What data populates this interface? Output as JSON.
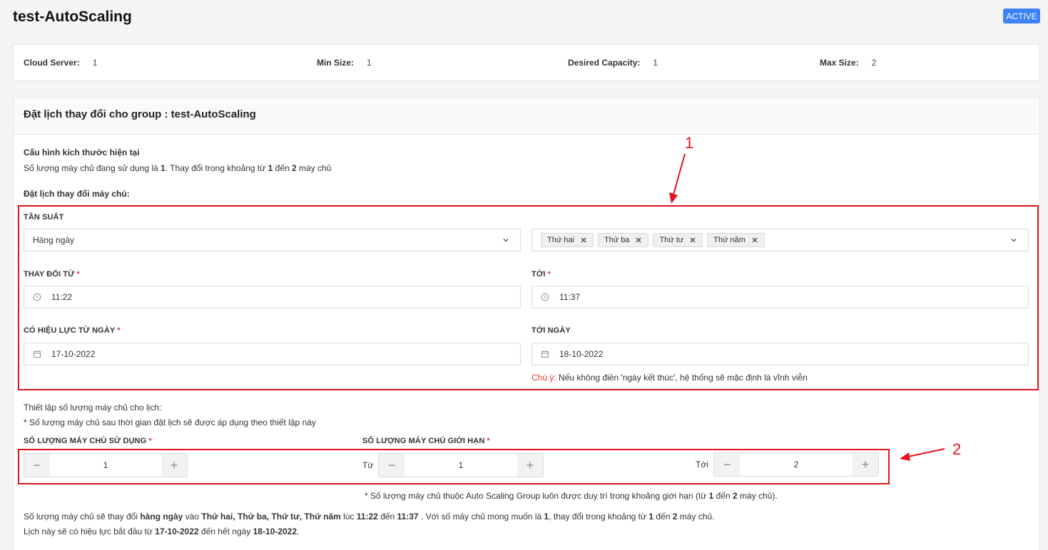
{
  "header": {
    "title": "test-AutoScaling",
    "status": "ACTIVE"
  },
  "summary": [
    {
      "label": "Cloud Server:",
      "value": "1"
    },
    {
      "label": "Min Size:",
      "value": "1"
    },
    {
      "label": "Desired Capacity:",
      "value": "1"
    },
    {
      "label": "Max Size:",
      "value": "2"
    }
  ],
  "card": {
    "title": "Đặt lịch thay đổi cho group : test-AutoScaling",
    "current_config_title": "Cấu hình kích thước hiện tại",
    "current_config": {
      "p1": "Số lượng máy chủ đang sử dụng là ",
      "v1": "1",
      "p2": ". Thay đổi trong khoảng từ ",
      "v2": "1",
      "p3": " đến ",
      "v3": "2",
      "p4": " máy chủ"
    },
    "schedule_title": "Đặt lịch thay đổi máy chủ:"
  },
  "form": {
    "frequency_label": "TẦN SUẤT",
    "frequency_value": "Hàng ngày",
    "days": [
      "Thứ hai",
      "Thứ ba",
      "Thứ tư",
      "Thứ năm"
    ],
    "from_time_label": "THAY ĐỔI TỪ",
    "from_time": "11:22",
    "to_time_label": "TỚI",
    "to_time": "11:37",
    "start_date_label": "CÓ HIỆU LỰC TỪ NGÀY",
    "start_date": "17-10-2022",
    "end_date_label": "TỚI NGÀY",
    "end_date": "18-10-2022",
    "note_prefix": "Chú ý:",
    "note_text": " Nếu không điền 'ngày kết thúc', hệ thống sẽ mặc định là vĩnh viễn",
    "required_mark": "*"
  },
  "capacity": {
    "title": "Thiết lập số lượng máy chủ cho lịch:",
    "subtitle": "* Số lượng máy chủ sau thời gian đặt lịch sẽ được áp dụng theo thiết lập này",
    "desired_label": "SỐ LƯỢNG MÁY CHỦ SỬ DỤNG",
    "desired_value": "1",
    "limit_label": "SỐ LƯỢNG MÁY CHỦ GIỚI HẠN",
    "from_label": "Từ",
    "min_value": "1",
    "to_label": "Tới",
    "max_value": "2",
    "limit_note": {
      "p1": "* Số lượng máy chủ thuộc Auto Scaling Group luôn được duy trì trong khoảng giới hạn (từ ",
      "v1": "1",
      "p2": " đến ",
      "v2": "2",
      "p3": " máy chủ)."
    }
  },
  "summary_text": {
    "l1": {
      "p1": "Số lượng máy chủ sẽ thay đổi ",
      "b1": "hàng ngày",
      "p2": " vào ",
      "b2": "Thứ hai, Thứ ba, Thứ tư, Thứ năm",
      "p3": " lúc ",
      "b3": "11:22",
      "p4": " đến ",
      "b4": "11:37",
      "p5": " . Với số máy chủ mong muốn là ",
      "b5": "1",
      "p6": ", thay đổi trong khoảng từ ",
      "b6": "1",
      "p7": " đến ",
      "b7": "2",
      "p8": " máy chủ."
    },
    "l2": {
      "p1": "Lịch này sẽ có hiệu lực bắt đầu từ ",
      "b1": "17-10-2022",
      "p2": " đến hết ngày ",
      "b2": "18-10-2022",
      "p3": "."
    }
  },
  "annotations": {
    "a1": "1",
    "a2": "2"
  },
  "colors": {
    "accent": "#3b82f6",
    "annotation": "#e0141e",
    "required": "#e53935"
  },
  "icons": {
    "dropdown": "chevron-down-icon",
    "tag_remove": "close-icon",
    "time": "clock-icon",
    "date": "calendar-icon",
    "decrement": "minus-icon",
    "increment": "plus-icon"
  }
}
